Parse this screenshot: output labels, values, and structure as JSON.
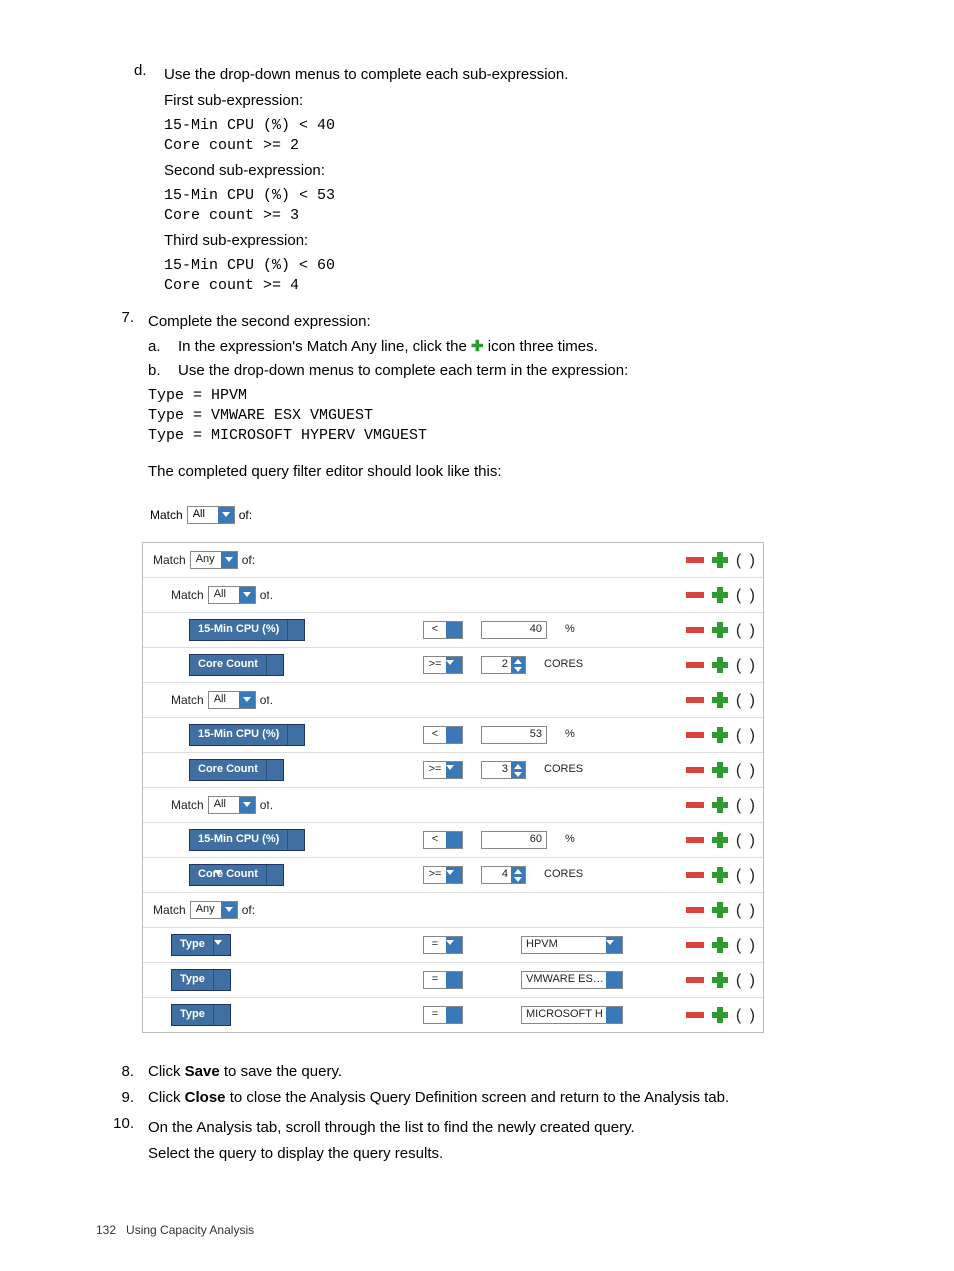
{
  "doc": {
    "d_letter": "d.",
    "d_text": "Use the drop-down menus to complete each sub-expression.",
    "first_lbl": "First sub-expression:",
    "first_code": "15-Min CPU (%) < 40\nCore count >= 2",
    "second_lbl": "Second sub-expression:",
    "second_code": "15-Min CPU (%) < 53\nCore count >= 3",
    "third_lbl": "Third sub-expression:",
    "third_code": "15-Min CPU (%) < 60\nCore count >= 4",
    "n7": "7.",
    "n7_text": "Complete the second expression:",
    "a_letter": "a.",
    "a_pre": "In the expression's Match Any line, click the ",
    "a_post": " icon three times.",
    "b_letter": "b.",
    "b_text": "Use the drop-down menus to complete each term in the expression:",
    "type_code": "Type = HPVM\nType = VMWARE ESX VMGUEST\nType = MICROSOFT HYPERV VMGUEST",
    "editor_intro": "The completed query filter editor should look like this:",
    "n8": "8.",
    "n8_pre": "Click ",
    "n8_b": "Save",
    "n8_post": " to save the query.",
    "n9": "9.",
    "n9_pre": "Click ",
    "n9_b": "Close",
    "n9_post": " to close the Analysis Query Definition screen and return to the Analysis tab.",
    "n10": "10.",
    "n10_text": "On the Analysis tab, scroll through the list to find the newly created query.",
    "n10_text2": "Select the query to display the query results.",
    "page_num": "132",
    "page_title": "Using Capacity Analysis"
  },
  "ed": {
    "hdr_match": "Match",
    "hdr_all": "All",
    "hdr_any": "Any",
    "hdr_of": "of:",
    "paren": "( )",
    "metric_cpu": "15-Min CPU (%)",
    "metric_core": "Core Count",
    "metric_type": "Type",
    "op_lt": "<",
    "op_gte": ">=",
    "op_eq": "=",
    "unit_pct": "%",
    "unit_cores": "CORES",
    "v40": "40",
    "v53": "53",
    "v60": "60",
    "v2": "2",
    "v3": "3",
    "v4": "4",
    "val_hpvm": "HPVM",
    "val_vmw": "VMWARE ES…",
    "val_ms": "MICROSOFT H"
  }
}
